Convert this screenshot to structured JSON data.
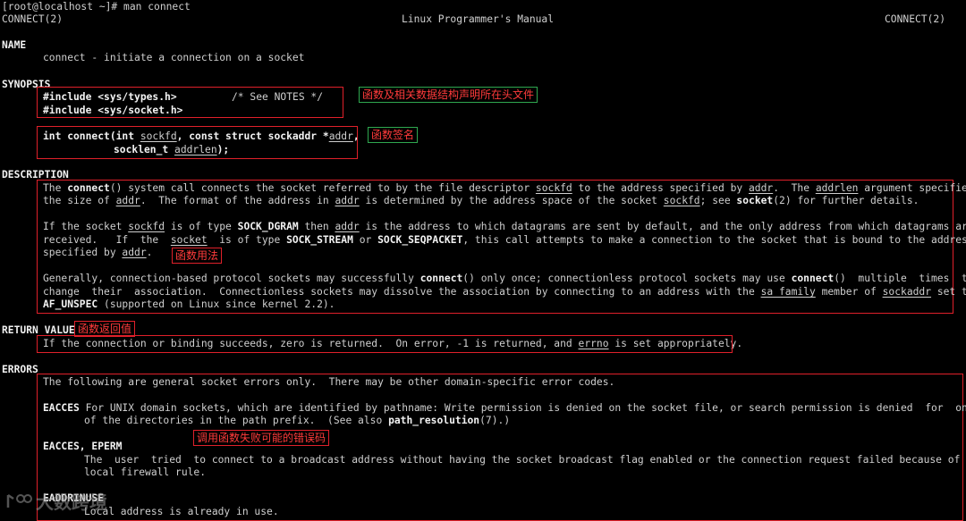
{
  "terminal": {
    "prompt": "[root@localhost ~]# man connect",
    "header_left": "CONNECT(2)",
    "header_center": "Linux Programmer's Manual",
    "header_right": "CONNECT(2)"
  },
  "name_section": {
    "heading": "NAME",
    "line": "connect - initiate a connection on a socket"
  },
  "synopsis": {
    "heading": "SYNOPSIS",
    "include1": "#include <sys/types.h>",
    "include1_comment": "/* See NOTES */",
    "include2": "#include <sys/socket.h>",
    "sig_prefix": "int connect(int ",
    "sig_sockfd": "sockfd",
    "sig_mid": ", const struct sockaddr *",
    "sig_addr": "addr",
    "sig_end": ",",
    "sig2_prefix": "socklen_t ",
    "sig2_addrlen": "addrlen",
    "sig2_end": ");"
  },
  "description": {
    "heading": "DESCRIPTION",
    "p1": {
      "l1": [
        "The ",
        "connect",
        "() system call connects the socket referred to by the file descriptor ",
        "sockfd",
        " to the address specified by ",
        "addr",
        ".  The ",
        "addrlen",
        " argument specifies"
      ],
      "l2": [
        "the size of ",
        "addr",
        ".  The format of the address in ",
        "addr",
        " is determined by the address space of the socket ",
        "sockfd",
        "; see ",
        "socket",
        "(2) for further details."
      ]
    },
    "p2": {
      "l1": [
        "If the socket ",
        "sockfd",
        " is of type ",
        "SOCK_DGRAM",
        " then ",
        "addr",
        " is the address to which datagrams are sent by default, and the only address from which datagrams are"
      ],
      "l2": [
        "received.   If  the  ",
        "socket",
        "  is of type ",
        "SOCK_STREAM",
        " or ",
        "SOCK_SEQPACKET",
        ", this call attempts to make a connection to the socket that is bound to the address"
      ],
      "l3": [
        "specified by ",
        "addr",
        "."
      ]
    },
    "p3": {
      "l1": [
        "Generally, connection-based protocol sockets may successfully ",
        "connect",
        "() only once; connectionless protocol sockets may use ",
        "connect",
        "()  multiple  times  to"
      ],
      "l2": [
        "change  their  association.  Connectionless sockets may dissolve the association by connecting to an address with the ",
        "sa_family",
        " member of ",
        "sockaddr",
        " set to"
      ],
      "l3": [
        "AF_UNSPEC",
        " (supported on Linux since kernel 2.2)."
      ]
    }
  },
  "return_value": {
    "heading": "RETURN VALUE",
    "line": [
      "If the connection or binding succeeds, zero is returned.  On error, -1 is returned, and ",
      "errno",
      " is set appropriately."
    ]
  },
  "errors": {
    "heading": "ERRORS",
    "intro": "The following are general socket errors only.  There may be other domain-specific error codes.",
    "eacces_label": "EACCES",
    "eacces_l1": " For UNIX domain sockets, which are identified by pathname: Write permission is denied on the socket file, or search permission is denied  for  one",
    "eacces_l2a": "of the directories in the path prefix.  (See also ",
    "eacces_l2b": "path_resolution",
    "eacces_l2c": "(7).)",
    "eperm_label": "EACCES, EPERM",
    "eperm_l1": "The  user  tried  to connect to a broadcast address without having the socket broadcast flag enabled or the connection request failed because of a",
    "eperm_l2": "local firewall rule.",
    "eaddrinuse_label": "EADDRINUSE",
    "eaddrinuse_l1": "Local address is already in use."
  },
  "annotations": {
    "headers": "函数及相关数据结构声明所在头文件",
    "signature": "函数签名",
    "usage": "函数用法",
    "return": "函数返回值",
    "errors": "调用函数失败可能的错误码"
  },
  "watermark": {
    "text": "大数跨境"
  },
  "colors": {
    "annotation_red": "#e0202a",
    "annotation_green": "#2fa84f"
  }
}
